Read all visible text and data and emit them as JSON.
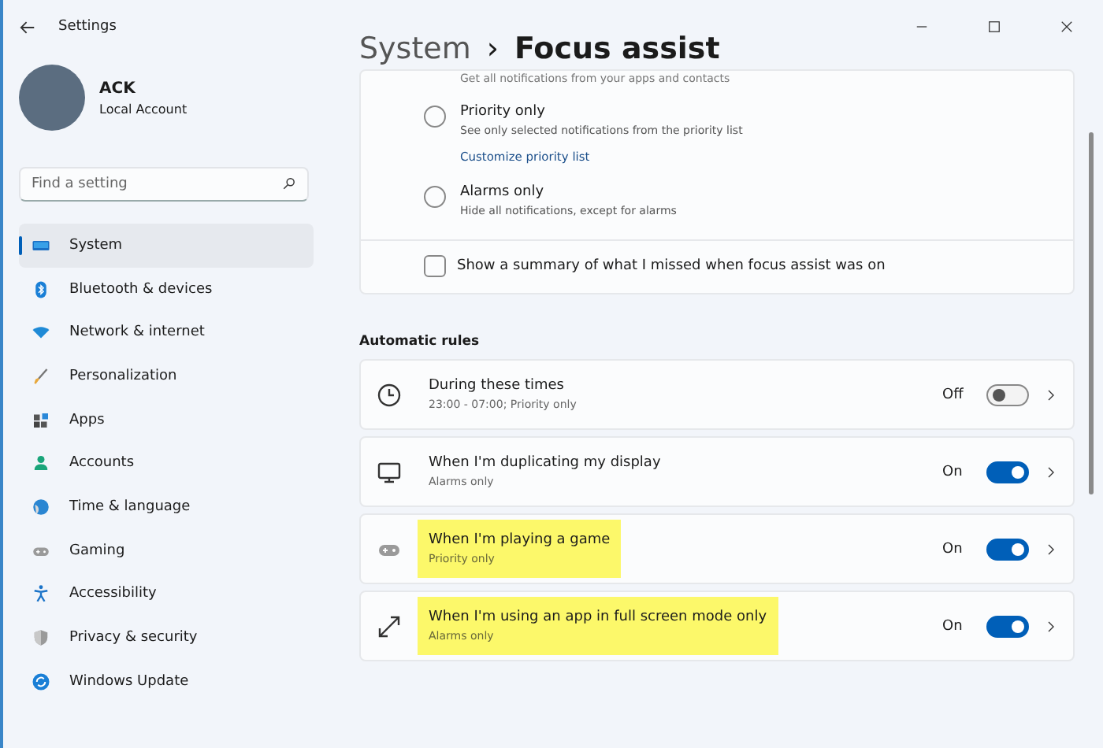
{
  "window": {
    "title": "Settings"
  },
  "account": {
    "name": "ACK",
    "type": "Local Account"
  },
  "search": {
    "placeholder": "Find a setting"
  },
  "sidebar": {
    "items": [
      {
        "label": "System",
        "kind": "system",
        "selected": true
      },
      {
        "label": "Bluetooth & devices",
        "kind": "bluetooth",
        "selected": false
      },
      {
        "label": "Network & internet",
        "kind": "network",
        "selected": false
      },
      {
        "label": "Personalization",
        "kind": "brush",
        "selected": false
      },
      {
        "label": "Apps",
        "kind": "apps",
        "selected": false
      },
      {
        "label": "Accounts",
        "kind": "person",
        "selected": false
      },
      {
        "label": "Time & language",
        "kind": "globe",
        "selected": false
      },
      {
        "label": "Gaming",
        "kind": "gamepad",
        "selected": false
      },
      {
        "label": "Accessibility",
        "kind": "accessibility",
        "selected": false
      },
      {
        "label": "Privacy & security",
        "kind": "shield",
        "selected": false
      },
      {
        "label": "Windows Update",
        "kind": "update",
        "selected": false
      }
    ]
  },
  "breadcrumb": {
    "parent": "System",
    "separator": "›",
    "current": "Focus assist"
  },
  "focus_options": {
    "cut_caption": "Get all notifications from your apps and contacts",
    "options": [
      {
        "label": "Priority only",
        "description": "See only selected notifications from the priority list",
        "link": "Customize priority list",
        "selected": false
      },
      {
        "label": "Alarms only",
        "description": "Hide all notifications, except for alarms",
        "selected": false
      }
    ],
    "summary": {
      "label": "Show a summary of what I missed when focus assist was on",
      "checked": false
    }
  },
  "automatic_rules": {
    "heading": "Automatic rules",
    "rules": [
      {
        "kind": "clock",
        "title": "During these times",
        "subtitle": "23:00 - 07:00; Priority only",
        "state": "Off",
        "on": false,
        "highlighted": false
      },
      {
        "kind": "monitor",
        "title": "When I'm duplicating my display",
        "subtitle": "Alarms only",
        "state": "On",
        "on": true,
        "highlighted": false
      },
      {
        "kind": "gamepad",
        "title": "When I'm playing a game",
        "subtitle": "Priority only",
        "state": "On",
        "on": true,
        "highlighted": true
      },
      {
        "kind": "expand",
        "title": "When I'm using an app in full screen mode only",
        "subtitle": "Alarms only",
        "state": "On",
        "on": true,
        "highlighted": true
      }
    ]
  }
}
